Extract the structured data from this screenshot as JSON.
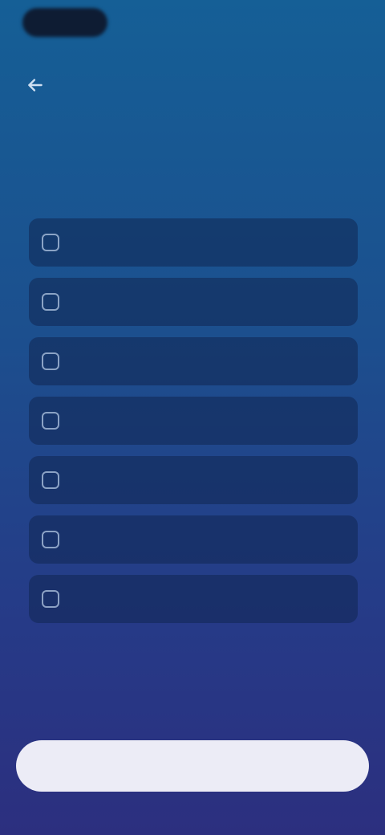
{
  "header": {
    "logo_icon": "app-logo-icon",
    "back_icon": "arrow-left-icon"
  },
  "intro": {
    "title": "",
    "subtitle": ""
  },
  "options": [
    {
      "label": ""
    },
    {
      "label": ""
    },
    {
      "label": ""
    },
    {
      "label": ""
    },
    {
      "label": ""
    },
    {
      "label": ""
    },
    {
      "label": ""
    }
  ],
  "footer": {
    "continue_label": ""
  },
  "colors": {
    "background_top": "#155f96",
    "background_bottom": "#2c2f7f",
    "button_background": "#ececf6",
    "button_text": "#2a2f6a"
  }
}
